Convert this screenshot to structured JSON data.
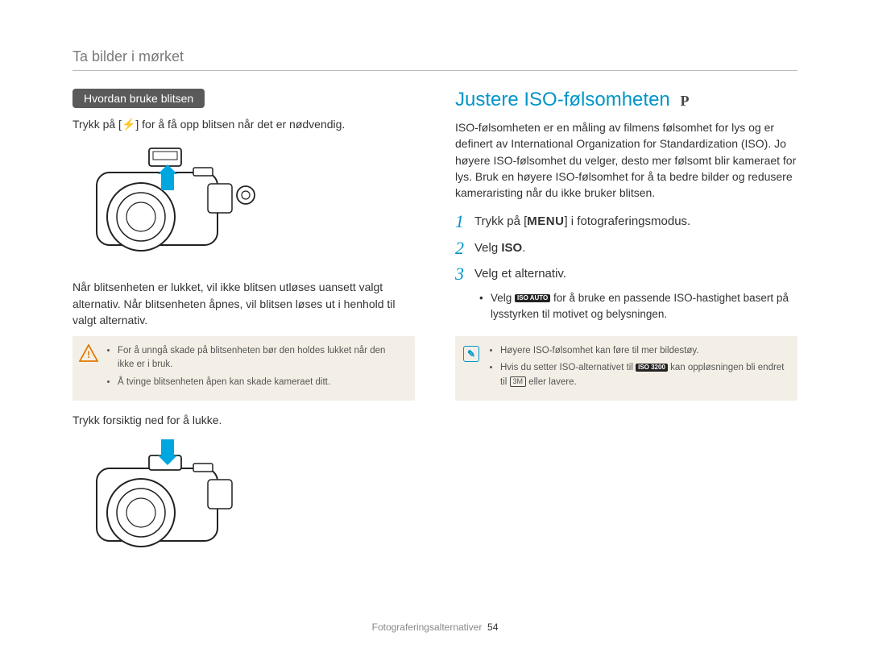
{
  "header": {
    "title": "Ta bilder i mørket"
  },
  "left": {
    "section_label": "Hvordan bruke blitsen",
    "intro_a": "Trykk på [",
    "flash_glyph": "⚡",
    "intro_b": "] for å få opp blitsen når det er nødvendig.",
    "closed_text": "Når blitsenheten er lukket, vil ikke blitsen utløses uansett valgt alternativ. Når blitsenheten åpnes, vil blitsen løses ut i henhold til valgt alternativ.",
    "warn1": "For å unngå skade på blitsenheten bør den holdes lukket når den ikke er i bruk.",
    "warn2": "Å tvinge blitsenheten åpen kan skade kameraet ditt.",
    "close_text": "Trykk forsiktig ned for å lukke."
  },
  "right": {
    "title": "Justere ISO-følsomheten",
    "mode_badge": "P",
    "intro": "ISO-følsomheten er en måling av filmens følsomhet for lys og er definert av International Organization for Standardization (ISO). Jo høyere ISO-følsomhet du velger, desto mer følsomt blir kameraet for lys. Bruk en høyere ISO-følsomhet for å ta bedre bilder og redusere kameraristing når du ikke bruker blitsen.",
    "step1_a": "Trykk på [",
    "step1_menu": "MENU",
    "step1_b": "] i fotograferingsmodus.",
    "step2_a": "Velg ",
    "step2_b": "ISO",
    "step2_c": ".",
    "step3": "Velg et alternativ.",
    "sub_a": "Velg ",
    "sub_chip": "ISO AUTO",
    "sub_b": " for å bruke en passende ISO-hastighet basert på lysstyrken til motivet og belysningen.",
    "note1": "Høyere ISO-følsomhet kan føre til mer bildestøy.",
    "note2_a": "Hvis du setter ISO-alternativet til ",
    "note2_chip": "ISO 3200",
    "note2_b": " kan oppløsningen bli endret til ",
    "note2_res": "3M",
    "note2_c": " eller lavere."
  },
  "footer": {
    "section": "Fotograferingsalternativer",
    "page": "54"
  }
}
